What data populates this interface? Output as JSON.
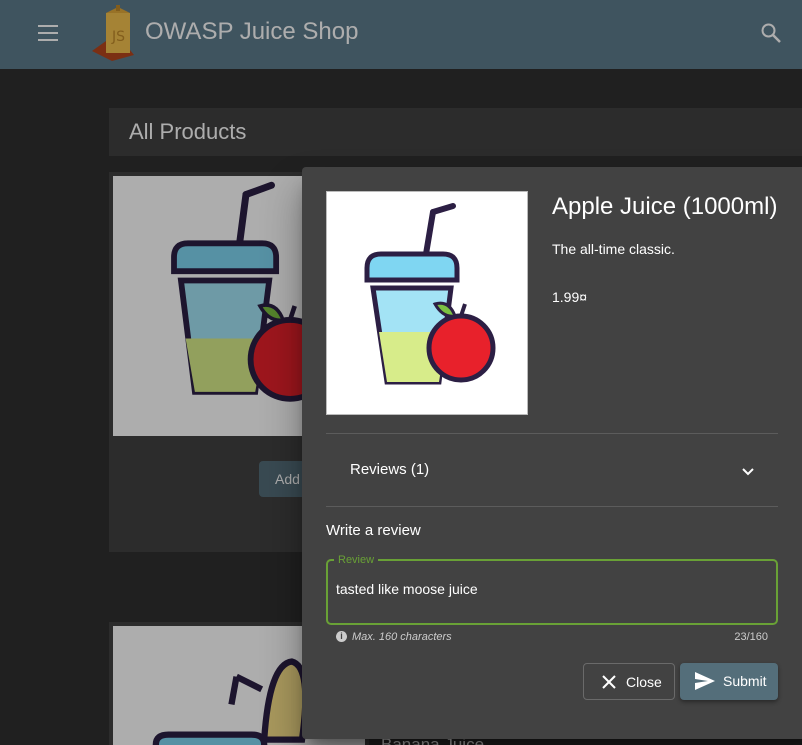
{
  "app": {
    "title": "OWASP Juice Shop"
  },
  "icons": {
    "menu": "menu-icon",
    "search": "search-icon",
    "logo": "juice-box-logo"
  },
  "products_page": {
    "title": "All Products",
    "add_button": "Add",
    "second_card_label": "Banana Juice"
  },
  "dialog": {
    "product_name": "Apple Juice (1000ml)",
    "description": "The all-time classic.",
    "price": "1.99¤",
    "reviews_title": "Reviews (1)",
    "write_review_title": "Write a review",
    "review_label": "Review",
    "review_value": "tasted like moose juice",
    "hint": "Max. 160 characters",
    "counter": "23/160",
    "close_label": "Close",
    "submit_label": "Submit"
  },
  "colors": {
    "toolbar": "#5e7c8d",
    "accent_green": "#69a136",
    "button": "#546e7a",
    "dialog_bg": "#424242"
  }
}
